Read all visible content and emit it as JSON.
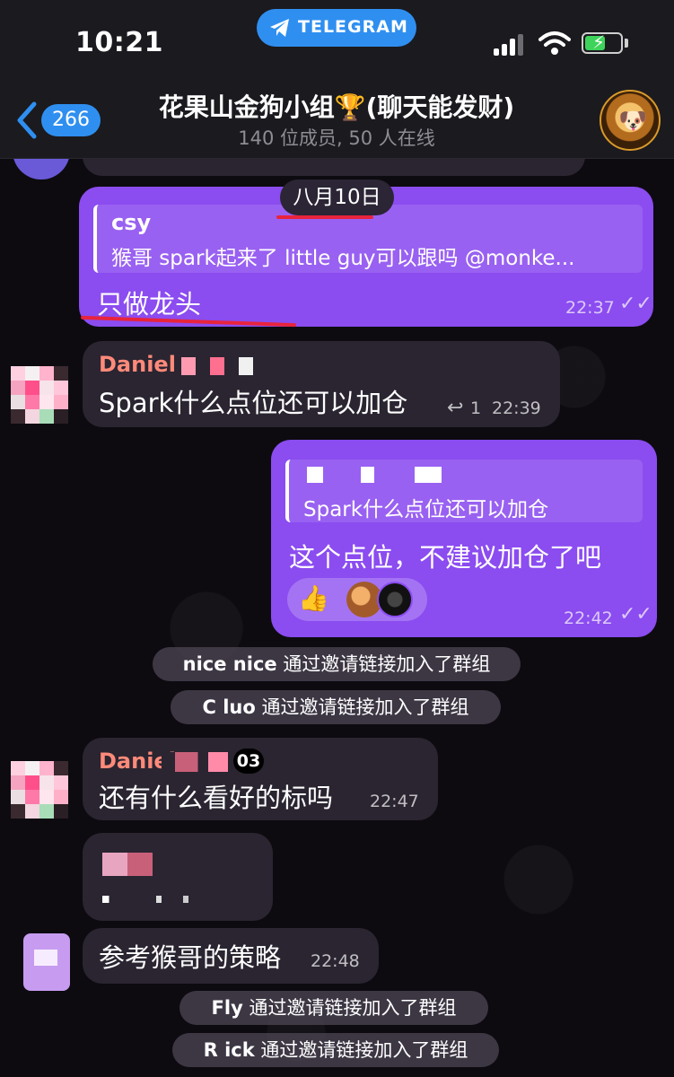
{
  "status_bar": {
    "time": "10:21",
    "app_pill": "TELEGRAM"
  },
  "header": {
    "back_count": "266",
    "title": "花果山金狗小组🏆(聊天能发财)",
    "subtitle": "140 位成员, 50 人在线"
  },
  "date_separator": "八月10日",
  "messages": [
    {
      "id": "m1",
      "direction": "out",
      "reply": {
        "author": "csy",
        "text": "猴哥 spark起来了 little guy可以跟吗 @monke..."
      },
      "text": "只做龙头",
      "time": "22:37"
    },
    {
      "id": "m2",
      "direction": "in",
      "sender": "Daniel",
      "text": "Spark什么点位还可以加仓",
      "replies": "1",
      "time": "22:39"
    },
    {
      "id": "m3",
      "direction": "out",
      "reply": {
        "author": "",
        "text": "Spark什么点位还可以加仓"
      },
      "text": "这个点位，不建议加仓了吧",
      "reaction": "👍",
      "time": "22:42"
    },
    {
      "id": "m4",
      "direction": "in",
      "sender": "Daniel",
      "sender_suffix": "03",
      "text": "还有什么看好的标吗",
      "time": "22:47"
    },
    {
      "id": "m5",
      "direction": "in",
      "text": "参考猴哥的策略",
      "time": "22:48"
    }
  ],
  "service_messages": [
    {
      "name": "nice nice",
      "action": " 通过邀请链接加入了群组"
    },
    {
      "name": "C luo",
      "action": " 通过邀请链接加入了群组"
    },
    {
      "name": "Fly",
      "action": " 通过邀请链接加入了群组"
    },
    {
      "name": "R ick",
      "action": " 通过邀请链接加入了群组"
    }
  ],
  "colors": {
    "outgoing_bubble": "#8b4cf0",
    "incoming_bubble": "#2a2531",
    "accent": "#2f8ff0",
    "sender_name": "#ff8a7a",
    "annotation_marker": "#e8243c"
  }
}
